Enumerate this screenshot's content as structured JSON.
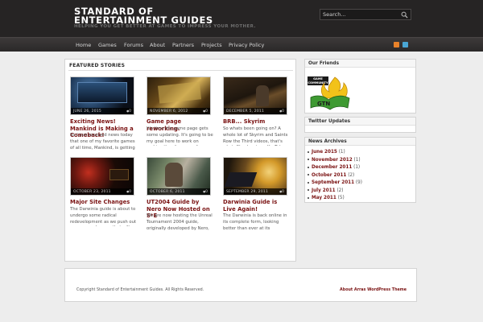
{
  "header": {
    "title": "STANDARD OF ENTERTAINMENT GUIDES",
    "tagline": "HELPING YOU GET BETTER AT GAMES TO IMPRESS YOUR MOTHER.",
    "search_placeholder": "Search...",
    "search_icon": "magnifier-icon"
  },
  "nav": {
    "items": [
      "Home",
      "Games",
      "Forums",
      "About",
      "Partners",
      "Projects",
      "Privacy Policy"
    ],
    "social_icons": [
      "rss-icon",
      "twitter-icon"
    ]
  },
  "featured": {
    "heading": "FEATURED STORIES",
    "posts": [
      {
        "date": "JUNE 26, 2015",
        "comments": "0",
        "title": "Exciting News! Mankind is Making a Comeback!",
        "excerpt": "So I just received news today that one of my favorite games of all time, Mankind, is getting"
      },
      {
        "date": "NOVEMBER 6, 2012",
        "comments": "0",
        "title": "Game page reworking.",
        "excerpt": "It's time the game page gets some updating. It's going to be my goal here to work on making the site more of a"
      },
      {
        "date": "DECEMBER 5, 2011",
        "comments": "0",
        "title": "BRB... Skyrim",
        "excerpt": "So whats been going on? A whole lot of Skyrim and Saints Row the Third videos, that's what. Check out our YouTube"
      },
      {
        "date": "OCTOBER 23, 2011",
        "comments": "0",
        "title": "Major Site Changes",
        "excerpt": "The Darwinia guide is about to undergo some radical redevelopment as we push out some new changes that will"
      },
      {
        "date": "OCTOBER 6, 2011",
        "comments": "0",
        "title": "UT2004 Guide by Nero Now Hosted on S*E",
        "excerpt": "We are now hosting the Unreal Tournament 2004 guide, originally developed by Nero,"
      },
      {
        "date": "SEPTEMBER 29, 2011",
        "comments": "0",
        "title": "Darwinia Guide is Live Again!",
        "excerpt": "The Darwinia is back online in its complete form, looking better than ever at its"
      }
    ]
  },
  "sidebar": {
    "friends": {
      "heading": "Our Friends",
      "logo_text": "GAME COMMUNITY"
    },
    "twitter": {
      "heading": "Twitter Updates"
    },
    "archives": {
      "heading": "News Archives",
      "items": [
        {
          "label": "June 2015",
          "count": "(1)"
        },
        {
          "label": "November 2012",
          "count": "(1)"
        },
        {
          "label": "December 2011",
          "count": "(1)"
        },
        {
          "label": "October 2011",
          "count": "(2)"
        },
        {
          "label": "September 2011",
          "count": "(9)"
        },
        {
          "label": "July 2011",
          "count": "(2)"
        },
        {
          "label": "May 2011",
          "count": "(5)"
        }
      ]
    }
  },
  "footer": {
    "copyright": "Copyright Standard of Entertainment Guides. All Rights Reserved.",
    "credit": "About Arras WordPress Theme"
  },
  "colors": {
    "header_bg": "#262424",
    "link": "#7a1212",
    "page_bg": "#ededed"
  }
}
